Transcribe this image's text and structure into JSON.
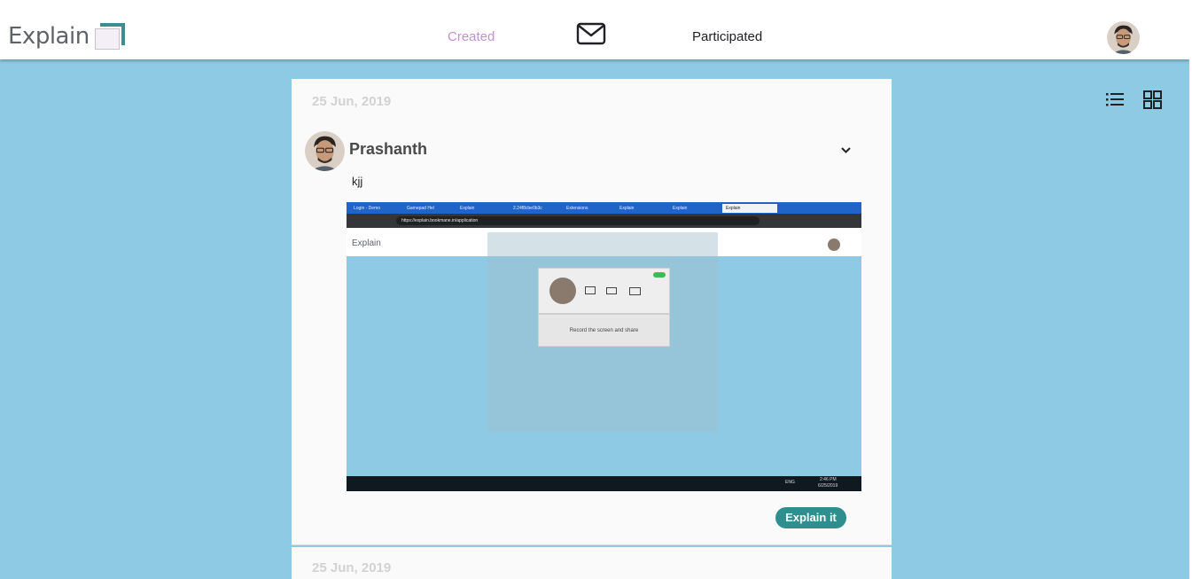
{
  "app": {
    "logo_text": "Explain"
  },
  "nav": {
    "created": "Created",
    "participated": "Participated",
    "active_color": "#c490d1"
  },
  "colors": {
    "background": "#8ecae4",
    "accent": "#2f8e8e"
  },
  "icons": [
    "mail-icon",
    "list-view-icon",
    "grid-view-icon",
    "chevron-down-icon",
    "user-avatar"
  ],
  "posts": [
    {
      "date": "25 Jun, 2019",
      "author": "Prashanth",
      "text": "kjj",
      "action_label": "Explain it",
      "screenshot": {
        "tabs": [
          "Login - Demo",
          "Gamepad Hel",
          "Explain",
          "2.24f8cbe0b3c",
          "Extensions",
          "Explain",
          "Explain",
          "Explain"
        ],
        "url": "https://explain.bookmane.in/application",
        "logo_text": "Explain",
        "popup_text": "Record the screen and share",
        "clock_time": "2:46 PM",
        "clock_date": "6/25/2019",
        "lang": "ENG"
      }
    },
    {
      "date": "25 Jun, 2019"
    }
  ]
}
